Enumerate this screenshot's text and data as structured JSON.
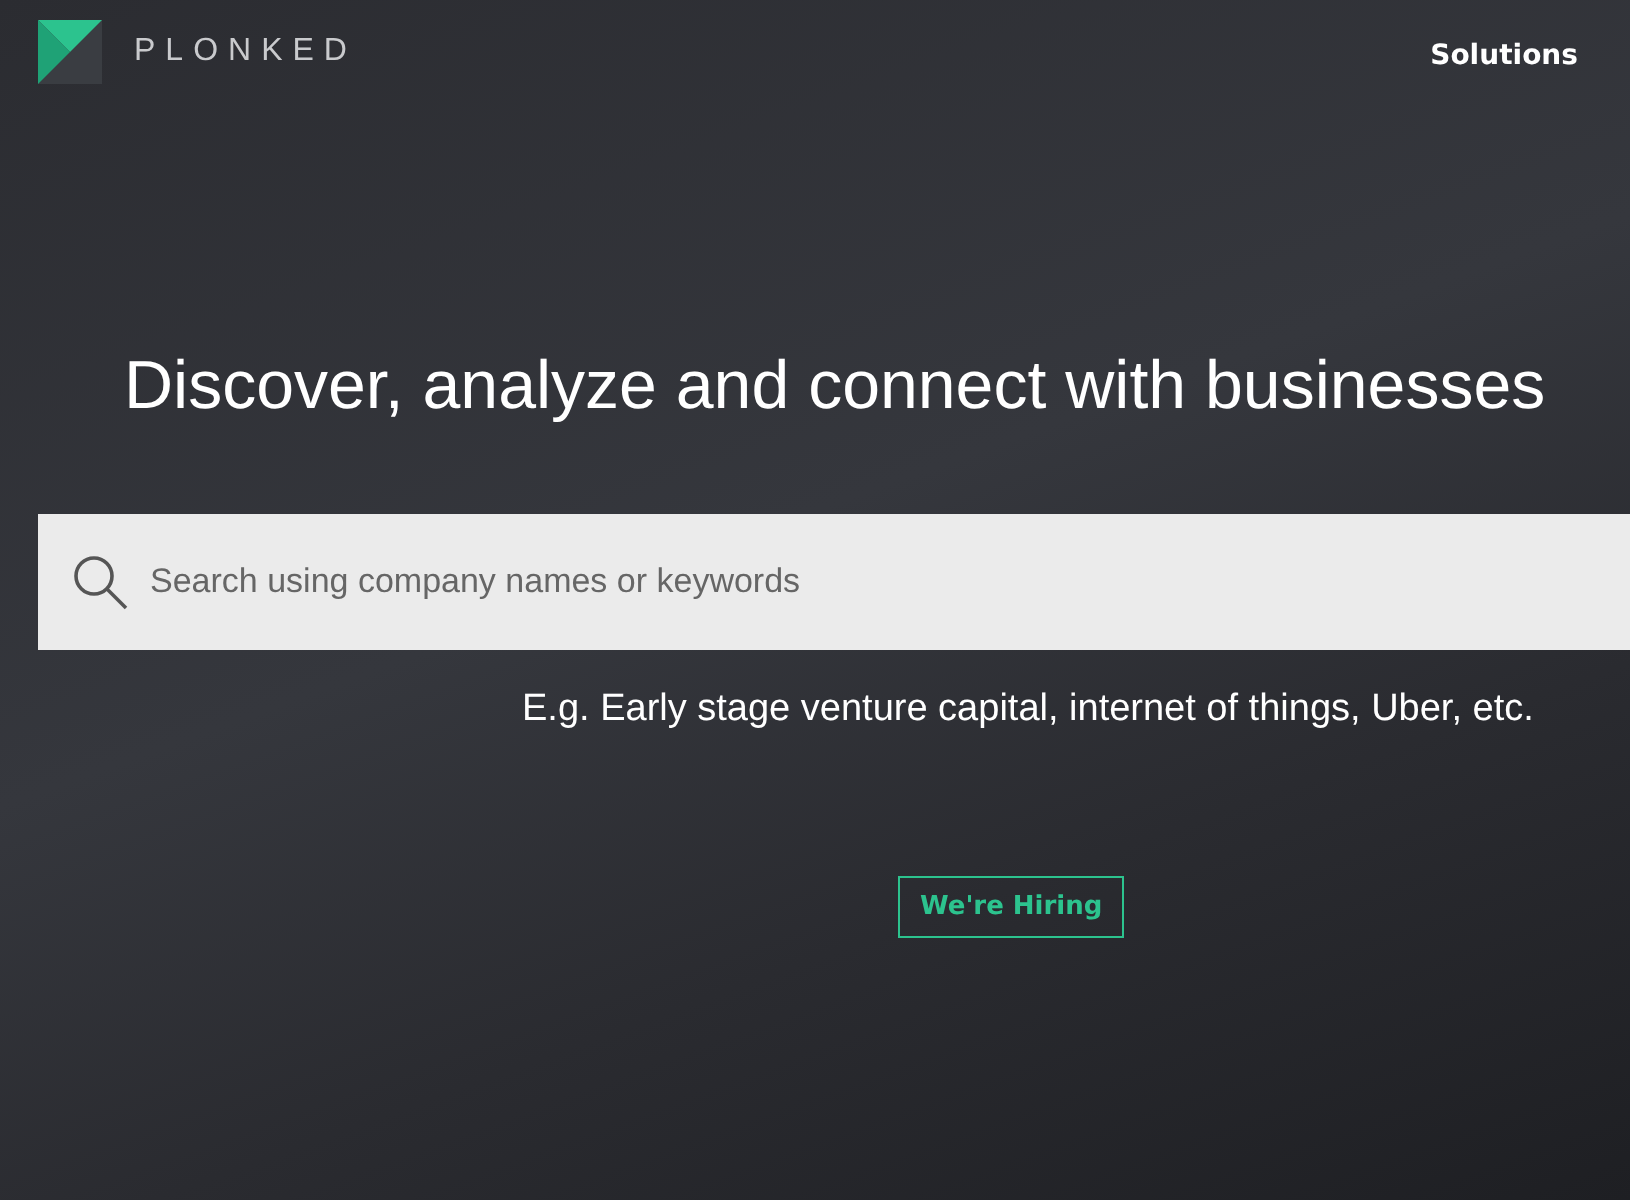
{
  "header": {
    "logo_text": "PLONKED",
    "nav": [
      {
        "label": "Solutions"
      }
    ]
  },
  "hero": {
    "headline": "Discover, analyze and connect with businesses",
    "search": {
      "placeholder": "Search using company names or keywords"
    },
    "example": "E.g. Early stage venture capital, internet of things, Uber, etc.",
    "button": "We're Hiring"
  }
}
